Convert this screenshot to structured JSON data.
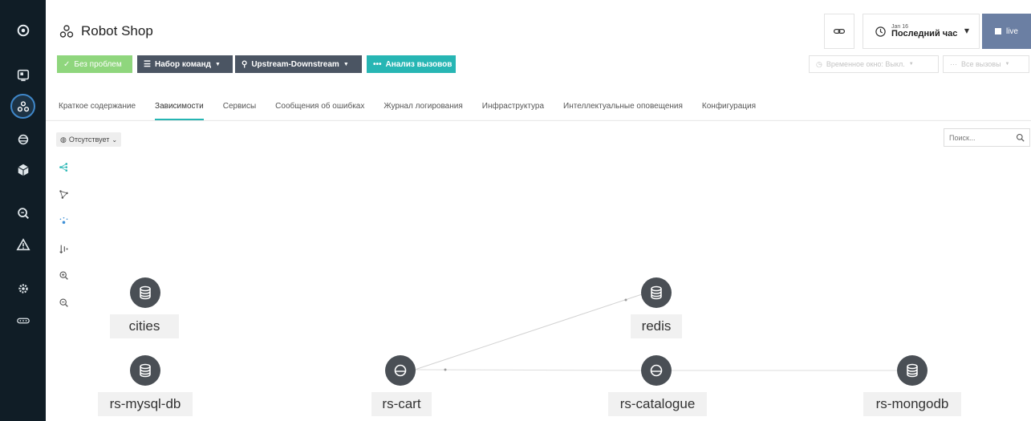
{
  "app": {
    "title": "Robot Shop"
  },
  "header": {
    "date_small": "Jan 16",
    "time_range": "Последний час",
    "live_label": "live"
  },
  "toolbar": {
    "status": "Без проблем",
    "command_set": "Набор команд",
    "upstream": "Upstream-Downstream",
    "call_analysis": "Анализ вызовов",
    "time_window": "Временное окно: Выкл.",
    "all_calls": "Все вызовы"
  },
  "tabs": [
    {
      "label": "Краткое содержание"
    },
    {
      "label": "Зависимости",
      "active": true
    },
    {
      "label": "Сервисы"
    },
    {
      "label": "Сообщения об ошибках"
    },
    {
      "label": "Журнал логирования"
    },
    {
      "label": "Инфраструктура"
    },
    {
      "label": "Интеллектуальные оповещения"
    },
    {
      "label": "Конфигурация"
    }
  ],
  "canvas": {
    "missing_label": "Отсутствует",
    "search_placeholder": "Поиск..."
  },
  "nodes": [
    {
      "id": "cities",
      "label": "cities",
      "icon": "database-icon"
    },
    {
      "id": "redis",
      "label": "redis",
      "icon": "database-icon"
    },
    {
      "id": "rs-mysql-db",
      "label": "rs-mysql-db",
      "icon": "database-icon"
    },
    {
      "id": "rs-cart",
      "label": "rs-cart",
      "icon": "service-icon"
    },
    {
      "id": "rs-catalogue",
      "label": "rs-catalogue",
      "icon": "service-icon"
    },
    {
      "id": "rs-mongodb",
      "label": "rs-mongodb",
      "icon": "database-icon"
    }
  ],
  "colors": {
    "rail": "#101d26",
    "status_green": "#8fd67d",
    "toolbar_dark": "#4b5563",
    "accent_teal": "#27b6b4",
    "live_blue": "#6b7fa3"
  }
}
